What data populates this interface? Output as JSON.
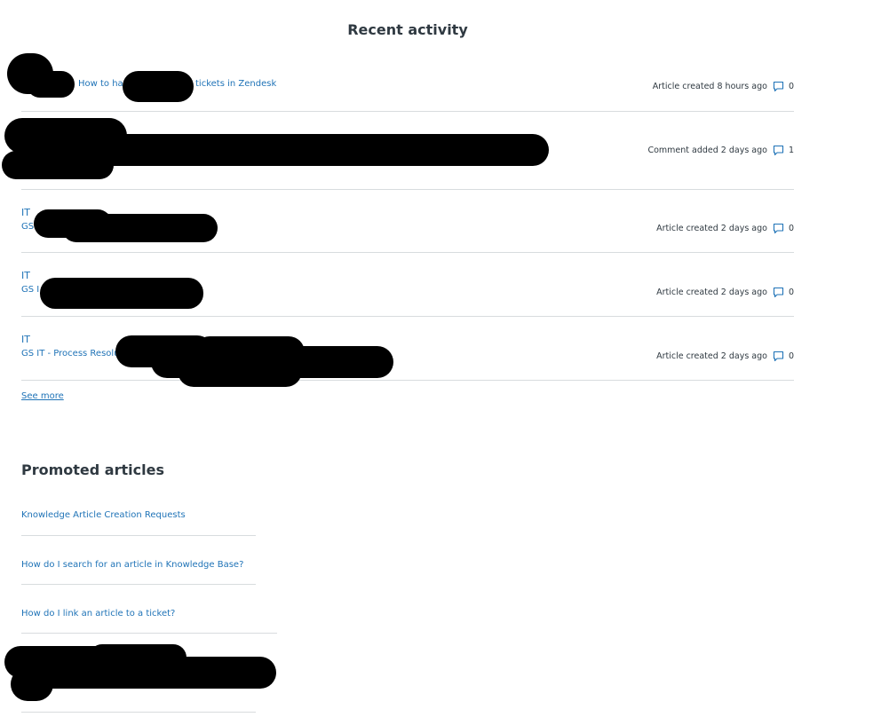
{
  "recent_activity": {
    "title": "Recent activity",
    "items": [
      {
        "parent": "",
        "title": "How to han",
        "title_tail": "tickets in Zendesk",
        "meta": "Article created 8 hours ago",
        "count": "0"
      },
      {
        "parent": "",
        "title": "",
        "title_tail": "",
        "meta": "Comment added 2 days ago",
        "count": "1"
      },
      {
        "parent": "IT",
        "title": "GS",
        "title_tail": "",
        "meta": "Article created 2 days ago",
        "count": "0"
      },
      {
        "parent": "IT",
        "title": "GS I",
        "title_tail": "",
        "meta": "Article created 2 days ago",
        "count": "0"
      },
      {
        "parent": "IT",
        "title": "GS IT - Process Resolut",
        "title_tail": "",
        "meta": "Article created 2 days ago",
        "count": "0"
      }
    ],
    "see_more": "See more"
  },
  "promoted_articles": {
    "title": "Promoted articles",
    "items": [
      {
        "label": "Knowledge Article Creation Requests"
      },
      {
        "label": "How do I search for an article in Knowledge Base?"
      },
      {
        "label": "How do I link an article to a ticket?"
      },
      {
        "label": ""
      }
    ]
  },
  "icons": {
    "comment": "comment-icon"
  },
  "colors": {
    "link": "#1f73b7",
    "text": "#2f3941",
    "divider": "#d8dcde",
    "redaction": "#000000"
  }
}
